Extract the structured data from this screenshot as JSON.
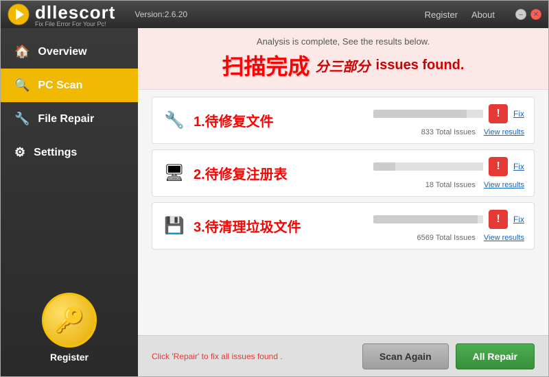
{
  "titlebar": {
    "brand": "dllescort",
    "brand_sub": "Fix File Error For Your Pc!",
    "version": "Version:2.6.20",
    "register_link": "Register",
    "about_link": "About"
  },
  "sidebar": {
    "items": [
      {
        "id": "overview",
        "label": "Overview",
        "icon": "🏠",
        "active": false
      },
      {
        "id": "pc-scan",
        "label": "PC Scan",
        "icon": "🔍",
        "active": true
      },
      {
        "id": "file-repair",
        "label": "File Repair",
        "icon": "🔧",
        "active": false
      },
      {
        "id": "settings",
        "label": "Settings",
        "icon": "⚙",
        "active": false
      }
    ],
    "register_label": "Register"
  },
  "content": {
    "analysis_text": "Analysis is complete, See the results below.",
    "scan_complete_title": "扫描完成",
    "issues_section_title": "分三部分",
    "issues_found_label": "issues found.",
    "results": [
      {
        "id": "file-repair",
        "title": "1.待修复文件",
        "icon": "🔧",
        "issues_count": "833 Total Issues",
        "bar_fill": 85,
        "fix_label": "Fix",
        "view_label": "View results"
      },
      {
        "id": "registry-cleaner",
        "title": "2.待修复注册表",
        "icon": "🖥",
        "issues_count": "18 Total Issues",
        "bar_fill": 20,
        "fix_label": "Fix",
        "view_label": "View results"
      },
      {
        "id": "disk-cleaner",
        "title": "3.待清理垃圾文件",
        "icon": "💾",
        "issues_count": "6569 Total Issues",
        "bar_fill": 95,
        "fix_label": "Fix",
        "view_label": "View results"
      }
    ]
  },
  "footer": {
    "hint_prefix": "Click 'Repair' to fix all issues found",
    "btn_scan_again": "Scan Again",
    "btn_all_repair": "All Repair"
  }
}
